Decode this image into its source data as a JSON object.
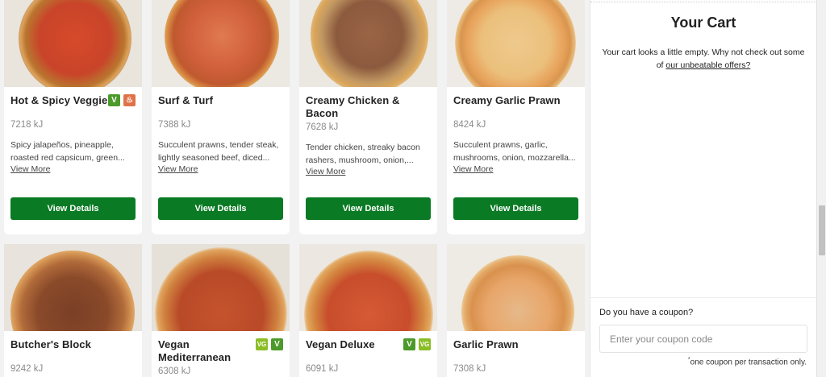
{
  "products": [
    {
      "title": "Hot & Spicy Veggie",
      "kj": "7218 kJ",
      "desc": "Spicy jalapeños, pineapple, roasted red capsicum, green...",
      "more": "View More",
      "button": "View Details",
      "badges": [
        "V",
        "hot"
      ]
    },
    {
      "title": "Surf & Turf",
      "kj": "7388 kJ",
      "desc": "Succulent prawns, tender steak, lightly seasoned beef, diced...",
      "more": "View More",
      "button": "View Details",
      "badges": []
    },
    {
      "title": "Creamy Chicken & Bacon",
      "kj": "7628 kJ",
      "desc": "Tender chicken, streaky bacon rashers, mushroom, onion,...",
      "more": "View More",
      "button": "View Details",
      "badges": []
    },
    {
      "title": "Creamy Garlic Prawn",
      "kj": "8424 kJ",
      "desc": "Succulent prawns, garlic, mushrooms, onion, mozzarella...",
      "more": "View More",
      "button": "View Details",
      "badges": []
    },
    {
      "title": "Butcher's Block",
      "kj": "9242 kJ",
      "badges": []
    },
    {
      "title": "Vegan Mediterranean",
      "kj": "6308 kJ",
      "badges": [
        "VG",
        "V"
      ]
    },
    {
      "title": "Vegan Deluxe",
      "kj": "6091 kJ",
      "badges": [
        "V",
        "VG"
      ]
    },
    {
      "title": "Garlic Prawn",
      "kj": "7308 kJ",
      "badges": []
    }
  ],
  "cart": {
    "title": "Your Cart",
    "message": "Your cart looks a little empty. Why not check out some of",
    "offers_link": "our unbeatable offers?",
    "coupon_question": "Do you have a coupon?",
    "coupon_placeholder": "Enter your coupon code",
    "coupon_note_mark": "*",
    "coupon_note": "one coupon per transaction only."
  },
  "colors": {
    "accent": "#0a7a24",
    "vegetarian": "#4c9a2a",
    "vegan": "#8bbd26",
    "spicy": "#e0724a"
  }
}
